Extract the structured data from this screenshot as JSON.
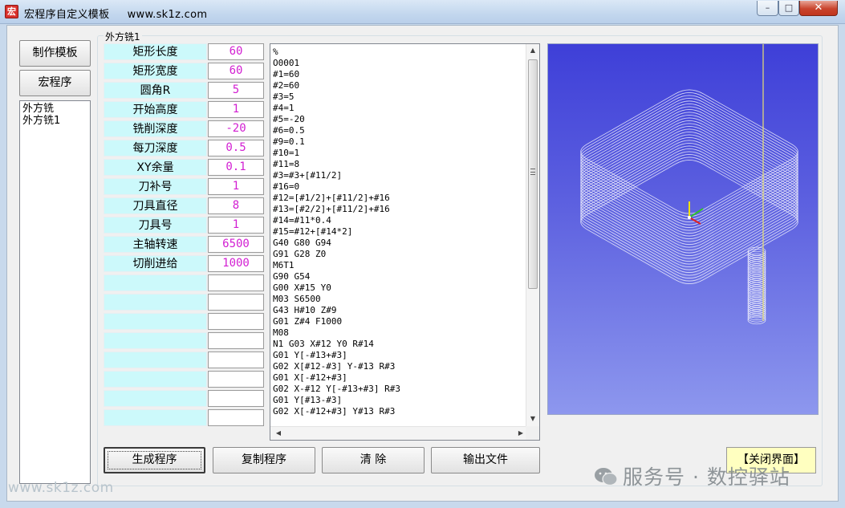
{
  "window": {
    "icon_glyph": "宏",
    "title": "宏程序自定义模板",
    "url": "www.sk1z.com",
    "min_glyph": "–",
    "max_glyph": "□",
    "close_glyph": "✕"
  },
  "left": {
    "make_template_label": "制作模板",
    "macro_label": "宏程序",
    "templates": [
      "外方铣",
      "外方铣1"
    ]
  },
  "group_title": "外方铣1",
  "params": [
    {
      "label": "矩形长度",
      "value": "60"
    },
    {
      "label": "矩形宽度",
      "value": "60"
    },
    {
      "label": "圆角R",
      "value": "5"
    },
    {
      "label": "开始高度",
      "value": "1"
    },
    {
      "label": "铣削深度",
      "value": "-20"
    },
    {
      "label": "每刀深度",
      "value": "0.5"
    },
    {
      "label": "XY余量",
      "value": "0.1"
    },
    {
      "label": "刀补号",
      "value": "1"
    },
    {
      "label": "刀具直径",
      "value": "8"
    },
    {
      "label": "刀具号",
      "value": "1"
    },
    {
      "label": "主轴转速",
      "value": "6500"
    },
    {
      "label": "切削进给",
      "value": "1000"
    },
    {
      "label": "",
      "value": ""
    },
    {
      "label": "",
      "value": ""
    },
    {
      "label": "",
      "value": ""
    },
    {
      "label": "",
      "value": ""
    },
    {
      "label": "",
      "value": ""
    },
    {
      "label": "",
      "value": ""
    },
    {
      "label": "",
      "value": ""
    },
    {
      "label": "",
      "value": ""
    }
  ],
  "code_lines": [
    "%",
    "O0001",
    "#1=60",
    "#2=60",
    "#3=5",
    "#4=1",
    "#5=-20",
    "#6=0.5",
    "#9=0.1",
    "#10=1",
    "#11=8",
    "#3=#3+[#11/2]",
    "#16=0",
    "#12=[#1/2]+[#11/2]+#16",
    "#13=[#2/2]+[#11/2]+#16",
    "#14=#11*0.4",
    "#15=#12+[#14*2]",
    "G40 G80 G94",
    "G91 G28 Z0",
    "M6T1",
    "G90 G54",
    "G00 X#15 Y0",
    "M03 S6500",
    "G43 H#10 Z#9",
    "G01 Z#4 F1000",
    "M08",
    "N1 G03 X#12 Y0 R#14",
    "G01 Y[-#13+#3]",
    "G02 X[#12-#3] Y-#13 R#3",
    "G01 X[-#12+#3]",
    "G02 X-#12 Y[-#13+#3] R#3",
    "G01 Y[#13-#3]",
    "G02 X[-#12+#3] Y#13 R#3"
  ],
  "scrollbar": {
    "up": "▲",
    "down": "▼",
    "left": "◀",
    "right": "▶"
  },
  "buttons": {
    "generate": "生成程序",
    "copy": "复制程序",
    "clear": "清  除",
    "export": "输出文件",
    "close": "【关闭界面】"
  },
  "watermark_left": "www.sk1z.com",
  "watermark_right": "服务号 · 数控驿站",
  "icons": {
    "window": "app-icon",
    "wechat": "wechat-icon"
  },
  "colors": {
    "param_label_bg": "#ccf9fb",
    "param_value": "#d21fd2",
    "close_button_bg": "#ffffc0",
    "view_bg_top": "#3e3fd8"
  }
}
